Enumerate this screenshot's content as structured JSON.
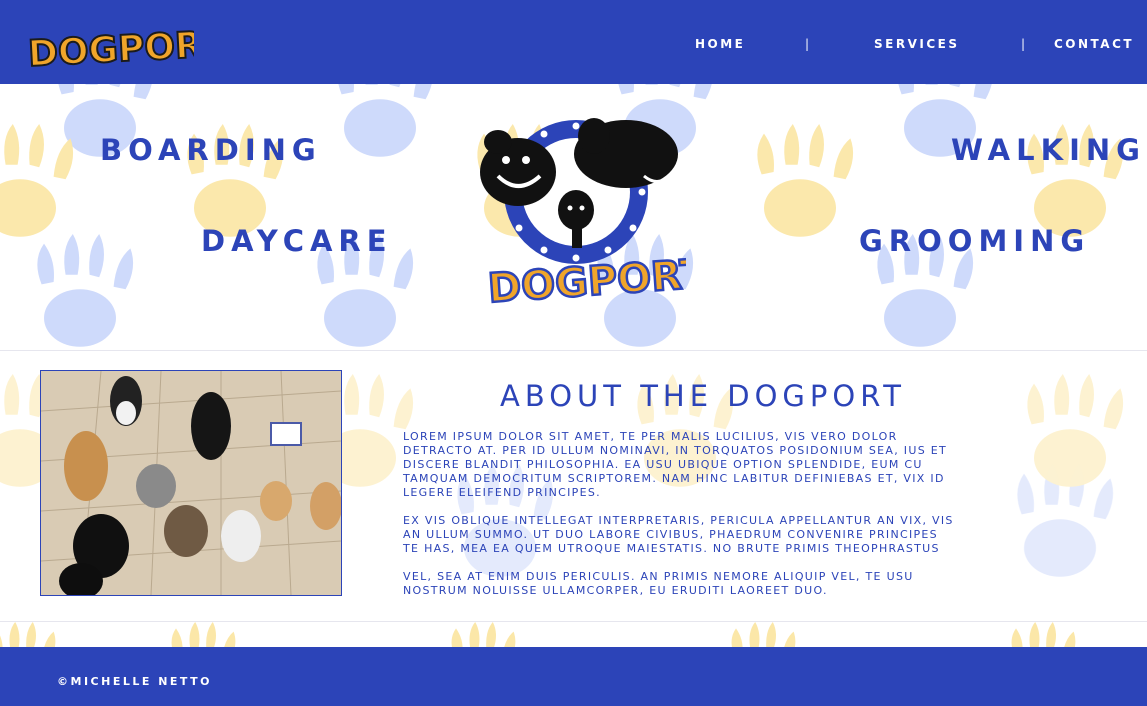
{
  "header": {
    "logo_text": "DOGPORT",
    "nav": [
      {
        "label": "HOME"
      },
      {
        "label": "SERVICES"
      },
      {
        "label": "CONTACT"
      }
    ],
    "separator": "|"
  },
  "hero": {
    "services": [
      "BOARDING",
      "DAYCARE",
      "WALKING",
      "GROOMING"
    ],
    "logo_text": "DOGPORT"
  },
  "about": {
    "title": "ABOUT THE DOGPORT",
    "paragraphs": [
      "Lorem ipsum dolor sit amet, te per malis lucilius, vis vero dolor detracto at. Per id ullum nominavi, in torquatos posidonium sea, ius et discere blandit philosophia. Ea usu ubique option splendide, eum cu tamquam democritum scriptorem. Nam hinc labitur definiebas et, vix id legere eleifend principes.",
      "Ex vis oblique intellegat interpretaris, pericula appellantur an vix, vis an ullum summo. Ut duo labore civibus, phaedrum convenire principes te has, mea ea quem utroque maiestatis. No brute primis theophrastus",
      "Vel, sea at enim duis periculis. An primis nemore aliquip vel, te usu nostrum noluisse ullamcorper, eu eruditi laoreet duo."
    ]
  },
  "footer": {
    "copyright": "©MICHELLE NETTO"
  },
  "colors": {
    "brand_blue": "#2c44b8",
    "paw_blue": "#c9d6fb",
    "paw_yellow": "#fbe7a8",
    "logo_orange": "#f0a52a"
  },
  "icons": [
    "paw-icon",
    "dog-icon"
  ]
}
